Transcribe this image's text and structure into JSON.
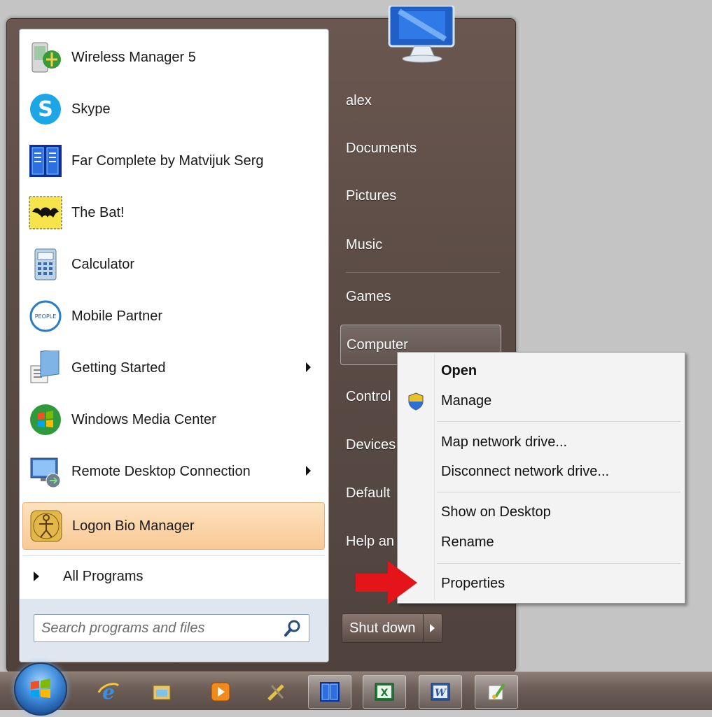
{
  "start_menu": {
    "programs": [
      {
        "label": "Wireless Manager 5",
        "icon": "wireless-manager-icon",
        "has_submenu": false
      },
      {
        "label": "Skype",
        "icon": "skype-icon",
        "has_submenu": false
      },
      {
        "label": "Far Complete by Matvijuk Serg",
        "icon": "far-manager-icon",
        "has_submenu": false
      },
      {
        "label": "The Bat!",
        "icon": "the-bat-icon",
        "has_submenu": false
      },
      {
        "label": "Calculator",
        "icon": "calculator-icon",
        "has_submenu": false
      },
      {
        "label": "Mobile Partner",
        "icon": "mobile-partner-icon",
        "has_submenu": false
      },
      {
        "label": "Getting Started",
        "icon": "getting-started-icon",
        "has_submenu": true
      },
      {
        "label": "Windows Media Center",
        "icon": "media-center-icon",
        "has_submenu": false
      },
      {
        "label": "Remote Desktop Connection",
        "icon": "remote-desktop-icon",
        "has_submenu": true
      },
      {
        "label": "Logon Bio Manager",
        "icon": "logon-bio-manager-icon",
        "has_submenu": false,
        "highlighted": true
      }
    ],
    "all_programs_label": "All Programs",
    "search_placeholder": "Search programs and files",
    "right_items": [
      {
        "label": "alex"
      },
      {
        "label": "Documents"
      },
      {
        "label": "Pictures"
      },
      {
        "label": "Music"
      },
      {
        "label": "Games"
      },
      {
        "label": "Computer",
        "active": true
      },
      {
        "label": "Control"
      },
      {
        "label": "Devices"
      },
      {
        "label": "Default"
      },
      {
        "label": "Help an"
      }
    ],
    "shutdown_label": "Shut down"
  },
  "context_menu": {
    "items": [
      {
        "label": "Open",
        "bold": true
      },
      {
        "label": "Manage",
        "icon": "uac-shield-icon"
      },
      {
        "label": "Map network drive..."
      },
      {
        "label": "Disconnect network drive..."
      },
      {
        "label": "Show on Desktop"
      },
      {
        "label": "Rename"
      },
      {
        "label": "Properties"
      }
    ]
  },
  "taskbar": {
    "items": [
      "internet-explorer-icon",
      "windows-explorer-icon",
      "media-player-icon",
      "tool-icon",
      "far-manager-icon",
      "excel-icon",
      "word-icon",
      "paint-icon"
    ]
  },
  "colors": {
    "menu_bg": "#5c4c46",
    "highlight": "#f9c994",
    "arrow": "#e3151a"
  }
}
